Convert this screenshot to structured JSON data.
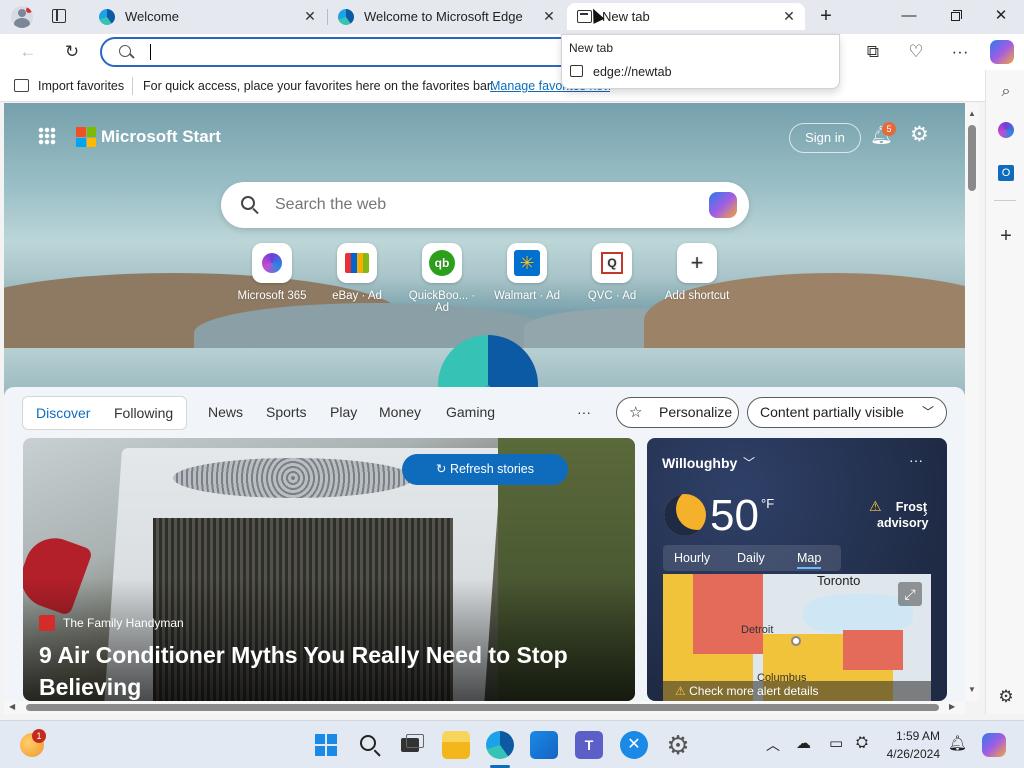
{
  "tabs": [
    {
      "title": "Welcome",
      "icon": "edge-icon",
      "active": false
    },
    {
      "title": "Welcome to Microsoft Edge",
      "icon": "edge-icon",
      "active": false
    },
    {
      "title": "New tab",
      "icon": "newtab-icon",
      "active": true
    }
  ],
  "address_bar": {
    "value": ""
  },
  "dropdown": {
    "header": "New tab",
    "item": "edge://newtab"
  },
  "favorites_bar": {
    "import_label": "Import favorites",
    "message": "For quick access, place your favorites here on the favorites bar.",
    "manage_link": "Manage favorites now"
  },
  "start": {
    "brand": "Microsoft Start",
    "sign_in": "Sign in",
    "notification_count": "5",
    "search_placeholder": "Search the web",
    "quick_links": [
      {
        "label": "Microsoft 365",
        "icon": "m365-icon"
      },
      {
        "label": "eBay · Ad",
        "icon": "ebay-icon"
      },
      {
        "label": "QuickBoo... · Ad",
        "icon": "quickbooks-icon"
      },
      {
        "label": "Walmart · Ad",
        "icon": "walmart-icon"
      },
      {
        "label": "QVC · Ad",
        "icon": "qvc-icon"
      },
      {
        "label": "Add shortcut",
        "icon": "plus-icon"
      }
    ],
    "feed_tabs": [
      "Discover",
      "Following"
    ],
    "nav": [
      "News",
      "Sports",
      "Play",
      "Money",
      "Gaming"
    ],
    "more": "···",
    "personalize": "Personalize",
    "content_visibility": "Content partially visible",
    "refresh": "Refresh stories",
    "story": {
      "source": "The Family Handyman",
      "headline": "9 Air Conditioner Myths You Really Need to Stop Believing"
    },
    "weather": {
      "location": "Willoughby",
      "temp": "50",
      "unit": "°F",
      "alert": "Frost advisory",
      "tabs": [
        "Hourly",
        "Daily",
        "Map"
      ],
      "selected_tab": "Map",
      "map_labels": [
        "Toronto",
        "Detroit",
        "Columbus"
      ],
      "alert_link": "Check more alert details"
    }
  },
  "taskbar": {
    "time": "1:59 AM",
    "date": "4/26/2024",
    "badge": "1"
  },
  "colors": {
    "accent": "#0f6cbd",
    "refresh_button": "#0f6cbd",
    "address_border": "#2b66c7",
    "weather_bg": "#2a3a5c"
  }
}
